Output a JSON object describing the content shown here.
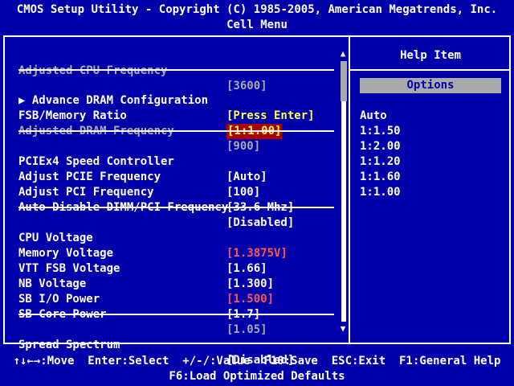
{
  "header": {
    "title": "CMOS Setup Utility - Copyright (C) 1985-2005, American Megatrends, Inc.",
    "menu": "Cell Menu"
  },
  "items": [
    {
      "label": "Adjusted CPU Frequency",
      "value": "[3600]"
    },
    {
      "label": "▶ Advance DRAM Configuration",
      "value": "[Press Enter]"
    },
    {
      "label": "FSB/Memory Ratio",
      "value": "[1:1.00]"
    },
    {
      "label": "Adjusted DRAM Frequency",
      "value": "[900]"
    },
    {
      "label": "PCIEx4 Speed Controller",
      "value": "[Auto]"
    },
    {
      "label": "Adjust PCIE Frequency",
      "value": "[100]"
    },
    {
      "label": "Adjust PCI Frequency",
      "value": "[33.6 Mhz]"
    },
    {
      "label": "Auto Disable DIMM/PCI Frequency",
      "value": "[Disabled]"
    },
    {
      "label": "CPU Voltage",
      "value": "[1.3875V]"
    },
    {
      "label": "Memory Voltage",
      "value": "[1.66]"
    },
    {
      "label": "VTT FSB Voltage",
      "value": "[1.300]"
    },
    {
      "label": "NB Voltage",
      "value": "[1.500]"
    },
    {
      "label": "SB I/O Power",
      "value": "[1.7]"
    },
    {
      "label": "SB Core Power",
      "value": "[1.05]"
    },
    {
      "label": "Spread Spectrum",
      "value": "[Disabled]"
    }
  ],
  "help": {
    "title": "Help Item",
    "options_label": "Options",
    "options": [
      "Auto",
      "1:1.50",
      "1:2.00",
      "1:1.20",
      "1:1.60",
      "1:1.00"
    ]
  },
  "scrollbar": {
    "up_glyph": "▲",
    "down_glyph": "▼"
  },
  "footer": {
    "line1": "↑↓←→:Move  Enter:Select  +/-/:Value  F10:Save  ESC:Exit  F1:General Help",
    "line2": "F6:Load Optimized Defaults"
  },
  "colors": {
    "background": "#0000aa",
    "text": "#ffffff",
    "disabled": "#aaaaaa",
    "warning": "#ff5555",
    "highlight": "#ffff55",
    "selected_bg": "#aa0000"
  }
}
